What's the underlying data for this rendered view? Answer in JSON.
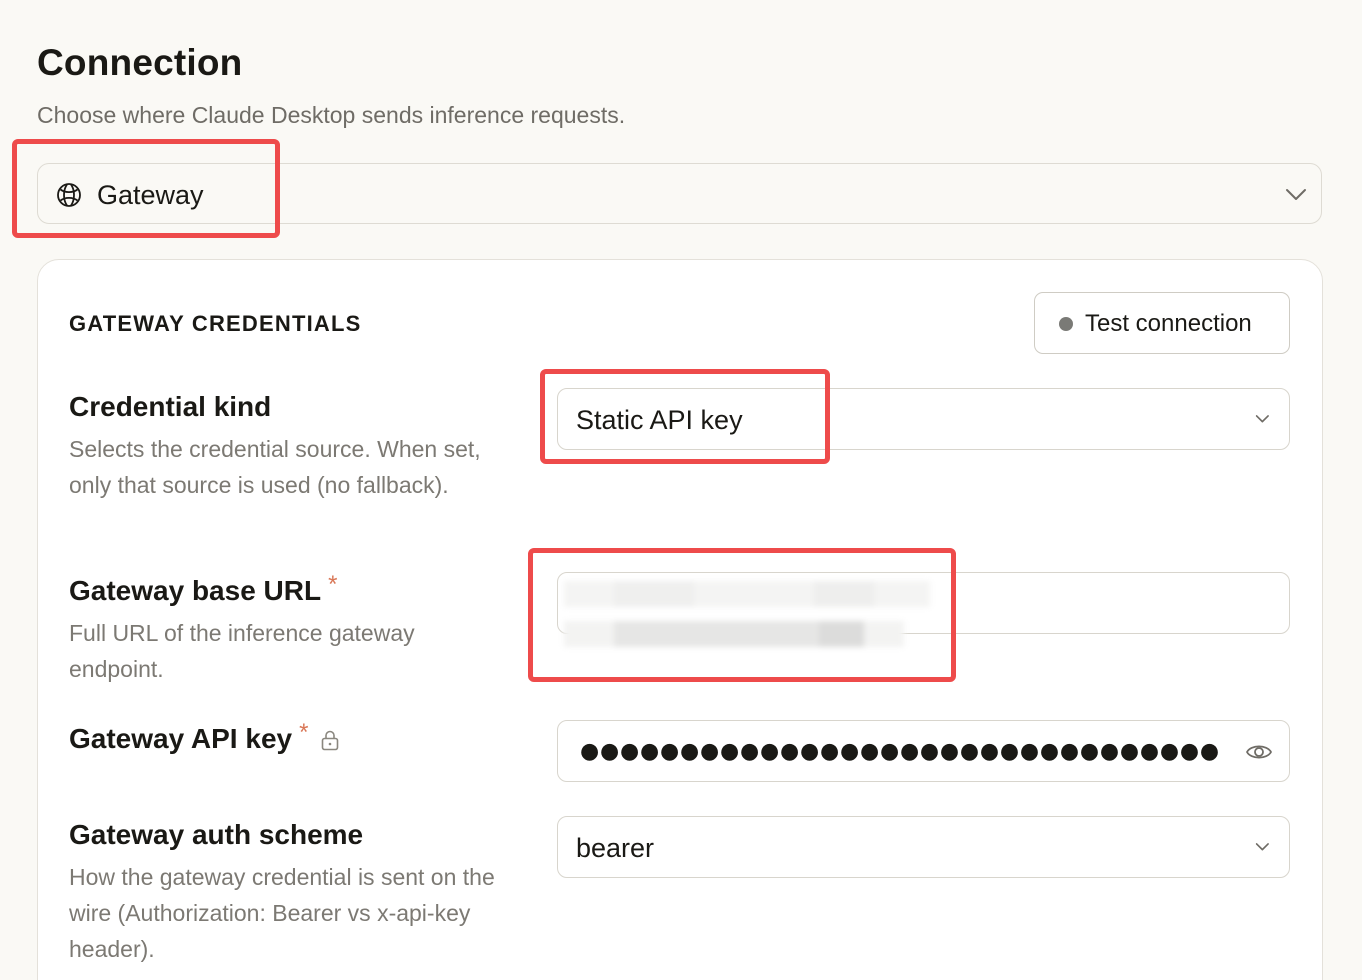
{
  "header": {
    "title": "Connection",
    "subtitle": "Choose where Claude Desktop sends inference requests."
  },
  "connection": {
    "selected": "Gateway",
    "icon": "globe-icon"
  },
  "credentials": {
    "section_title": "GATEWAY CREDENTIALS",
    "test_button": "Test connection",
    "credential_kind": {
      "label": "Credential kind",
      "description": "Selects the credential source. When set, only that source is used (no fallback).",
      "value": "Static API key"
    },
    "base_url": {
      "label": "Gateway base URL",
      "required_mark": "*",
      "description": "Full URL of the inference gateway endpoint.",
      "value": ""
    },
    "api_key": {
      "label": "Gateway API key",
      "required_mark": "*",
      "masked_value": "●●●●●●●●●●●●●●●●●●●●●●●●●●●●●●●●●●●●●●●●●●●●●●●●●●●●●●●●●●●●●●●●●●●●●●●",
      "lock_icon": "lock-icon",
      "reveal_icon": "eye-icon"
    },
    "auth_scheme": {
      "label": "Gateway auth scheme",
      "description": "How the gateway credential is sent on the wire (Authorization: Bearer vs x-api-key header).",
      "value": "bearer"
    }
  },
  "colors": {
    "background": "#faf9f5",
    "card": "#ffffff",
    "required_asterisk": "#d97757",
    "highlight": "#ee4b4b",
    "status_dot": "#7a7a76"
  }
}
